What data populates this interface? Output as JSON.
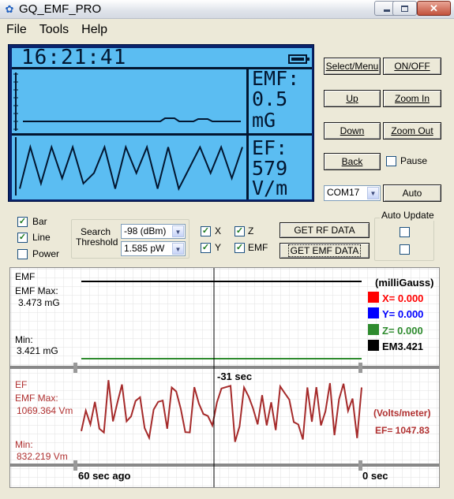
{
  "window": {
    "title": "GQ_EMF_PRO",
    "minimize_icon": "minimize-icon",
    "maximize_icon": "maximize-icon",
    "close_icon": "close-icon"
  },
  "menu": [
    "File",
    "Tools",
    "Help"
  ],
  "lcd": {
    "time": "16:21:41",
    "emf_label": "EMF:",
    "emf_value": "0.5",
    "emf_unit": "mG",
    "ef_label": "EF:",
    "ef_value": "579",
    "ef_unit": "V/m",
    "battery_icon": "battery-icon"
  },
  "buttons": {
    "select_menu": "Select/Menu",
    "on_off": "ON/OFF",
    "up": "Up",
    "zoom_in": "Zoom In",
    "down": "Down",
    "zoom_out": "Zoom Out",
    "back": "Back",
    "pause": "Pause",
    "auto": "Auto",
    "get_rf": "GET RF DATA",
    "get_emf": "GET EMF DATA"
  },
  "port": {
    "selected": "COM17"
  },
  "options": {
    "bar": "Bar",
    "line": "Line",
    "power": "Power",
    "bar_checked": true,
    "line_checked": true,
    "power_checked": false
  },
  "search": {
    "label_line1": "Search",
    "label_line2": "Threshold",
    "dbm": "-98 (dBm)",
    "pw": "1.585 pW"
  },
  "axes": {
    "x": "X",
    "y": "Y",
    "z": "Z",
    "emf": "EMF",
    "x_checked": true,
    "y_checked": true,
    "z_checked": true,
    "emf_checked": true
  },
  "auto_update": {
    "label": "Auto Update"
  },
  "graph": {
    "emf_title": "EMF",
    "emf_max_label": "EMF Max:",
    "emf_max_value": "3.473 mG",
    "emf_min_label": "Min:",
    "emf_min_value": "3.421 mG",
    "unit_label": "(milliGauss)",
    "x_readout": "X= 0.000",
    "y_readout": "Y= 0.000",
    "z_readout": "Z= 0.000",
    "em_readout": "EM3.421",
    "cursor_time": "-31 sec",
    "ef_title": "EF",
    "ef_max_label": "EMF Max:",
    "ef_max_value": "1069.364 Vm",
    "ef_min_label": "Min:",
    "ef_min_value": "832.219 Vm",
    "ef_unit_label": "(Volts/meter)",
    "ef_readout": "EF= 1047.83",
    "left_time": "60 sec ago",
    "right_time": "0 sec"
  },
  "colors": {
    "x": "#ff0000",
    "y": "#0000ff",
    "z": "#2e8b2e",
    "em": "#000000",
    "ef_line": "#a52a2a",
    "ef_text": "#b03030",
    "lcd_bg": "#5bbdf2"
  },
  "ef_series": [
    917,
    978,
    937,
    1004,
    924,
    913,
    1069,
    946,
    1003,
    1056,
    946,
    961,
    1007,
    1018,
    926,
    897,
    981,
    1004,
    1008,
    924,
    1047,
    1035,
    983,
    914,
    913,
    1048,
    999,
    968,
    962,
    934,
    1003,
    1044,
    1048,
    1052,
    885,
    931,
    1047,
    1020,
    984,
    937,
    1024,
    934,
    1003,
    920,
    1050,
    1030,
    1011,
    944,
    937,
    892,
    1047,
    945,
    1048,
    934,
    976,
    1060,
    905,
    1012,
    1058,
    977,
    1014,
    896,
    1047
  ],
  "lcd_ef_series": [
    0.1,
    0.9,
    0.2,
    0.9,
    0.3,
    0.9,
    0.2,
    0.4,
    0.9,
    0.1,
    0.9,
    0.4,
    0.9,
    0.1,
    0.9,
    0.1,
    0.5,
    0.9,
    0.4,
    0.9,
    0.3,
    0.9
  ]
}
